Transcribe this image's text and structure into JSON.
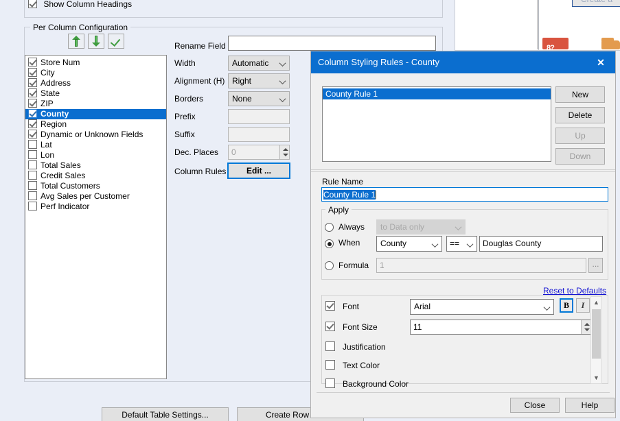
{
  "host": {
    "show_column_headings_label": "Show Column Headings",
    "show_column_headings_checked": true,
    "per_column_group_label": "Per Column Configuration",
    "toolbar": {
      "move_up_tooltip": "Move Up",
      "move_down_tooltip": "Move Down",
      "check_tooltip": "Check All"
    },
    "columns": [
      {
        "label": "Store Num",
        "checked": true,
        "selected": false
      },
      {
        "label": "City",
        "checked": true,
        "selected": false
      },
      {
        "label": "Address",
        "checked": true,
        "selected": false
      },
      {
        "label": "State",
        "checked": true,
        "selected": false
      },
      {
        "label": "ZIP",
        "checked": true,
        "selected": false
      },
      {
        "label": "County",
        "checked": true,
        "selected": true
      },
      {
        "label": "Region",
        "checked": true,
        "selected": false
      },
      {
        "label": "Dynamic or Unknown Fields",
        "checked": true,
        "selected": false
      },
      {
        "label": "Lat",
        "checked": false,
        "selected": false
      },
      {
        "label": "Lon",
        "checked": false,
        "selected": false
      },
      {
        "label": "Total Sales",
        "checked": false,
        "selected": false
      },
      {
        "label": "Credit Sales",
        "checked": false,
        "selected": false
      },
      {
        "label": "Total Customers",
        "checked": false,
        "selected": false
      },
      {
        "label": "Avg Sales per Customer",
        "checked": false,
        "selected": false
      },
      {
        "label": "Perf Indicator",
        "checked": false,
        "selected": false
      }
    ],
    "fields": {
      "rename_label": "Rename Field",
      "rename_value": "",
      "width_label": "Width",
      "width_value": "Automatic",
      "alignment_label": "Alignment (H)",
      "alignment_value": "Right",
      "borders_label": "Borders",
      "borders_value": "None",
      "prefix_label": "Prefix",
      "prefix_value": "",
      "suffix_label": "Suffix",
      "suffix_value": "",
      "dec_places_label": "Dec. Places",
      "dec_places_value": "0",
      "column_rules_label": "Column Rules",
      "edit_button_label": "Edit ..."
    },
    "footer": {
      "default_table_settings_label": "Default Table Settings...",
      "create_row_rule_label": "Create Row Rule...",
      "create_button_label": "Create a"
    }
  },
  "dialog": {
    "title": "Column Styling Rules - County",
    "close_icon_label": "✕",
    "rules_list": [
      {
        "label": "County  Rule 1",
        "selected": true
      }
    ],
    "side_buttons": [
      {
        "label": "New",
        "enabled": true
      },
      {
        "label": "Delete",
        "enabled": true
      },
      {
        "label": "Up",
        "enabled": false
      },
      {
        "label": "Down",
        "enabled": false
      }
    ],
    "rule_name_label": "Rule Name",
    "rule_name_value": "County  Rule 1",
    "apply": {
      "group_label": "Apply",
      "always_label": "Always",
      "always_selected": false,
      "always_scope_value": "to Data only",
      "when_label": "When",
      "when_selected": true,
      "when_field": "County",
      "when_operator": "==",
      "when_value": "Douglas County",
      "formula_label": "Formula",
      "formula_selected": false,
      "formula_value": "1",
      "formula_browse_label": "..."
    },
    "reset_link_label": "Reset to Defaults",
    "style_rows": [
      {
        "label": "Font",
        "checked": true
      },
      {
        "label": "Font Size",
        "checked": true
      },
      {
        "label": "Justification",
        "checked": false
      },
      {
        "label": "Text Color",
        "checked": false
      },
      {
        "label": "Background Color",
        "checked": false
      }
    ],
    "font_value": "Arial",
    "font_size_value": "11",
    "bold_label": "B",
    "bold_active": true,
    "italic_label": "I",
    "italic_active": false,
    "close_button_label": "Close",
    "help_button_label": "Help"
  },
  "colors": {
    "accent_blue": "#0b6ecf",
    "window_bg": "#eaeef7",
    "dialog_bg": "#f0f0f0",
    "link_blue": "#1414d2",
    "focus_blue": "#0078d7",
    "green_arrow": "#5fbf5f",
    "icon_red": "#d9543f",
    "icon_orange": "#e39b4e"
  }
}
